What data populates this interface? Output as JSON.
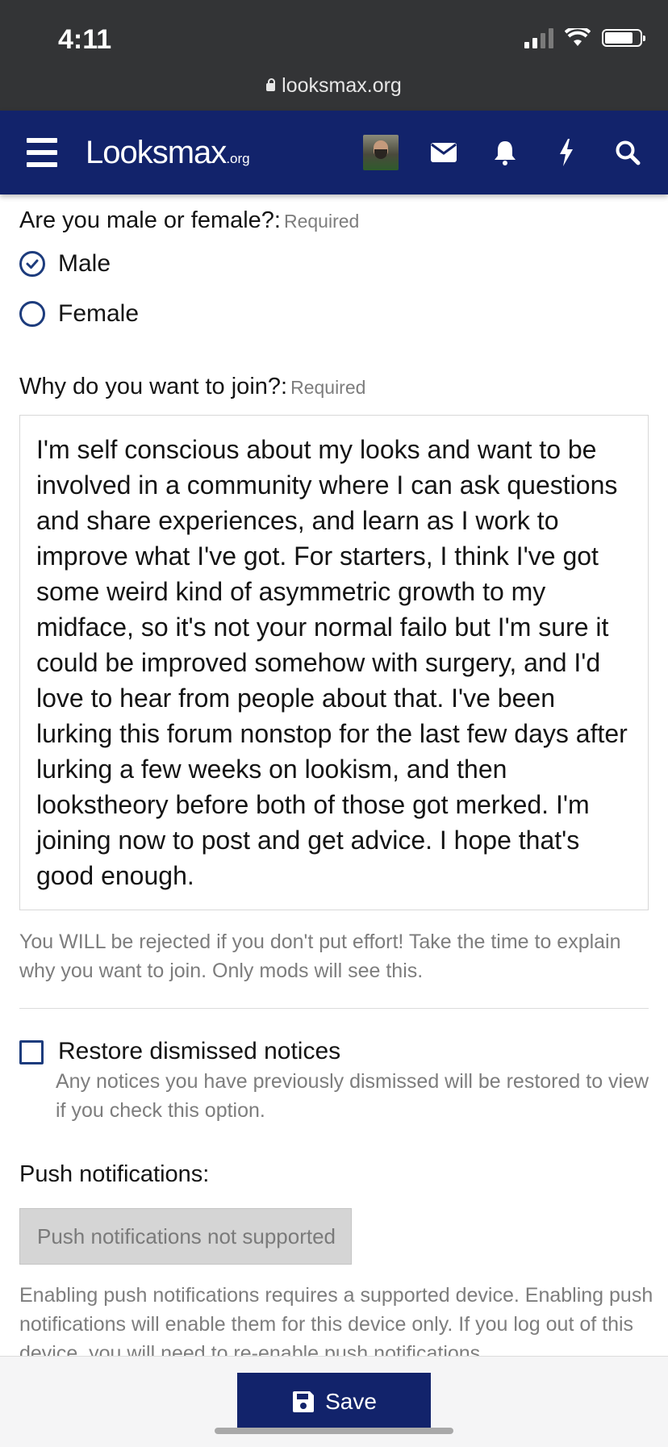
{
  "status_bar": {
    "time": "4:11"
  },
  "browser": {
    "url": "looksmax.org"
  },
  "header": {
    "logo": "Looksmax",
    "logo_suffix": ".org"
  },
  "form": {
    "gender": {
      "label": "Are you male or female?:",
      "required": "Required",
      "options": [
        {
          "label": "Male",
          "checked": true
        },
        {
          "label": "Female",
          "checked": false
        }
      ]
    },
    "why_join": {
      "label": "Why do you want to join?:",
      "required": "Required",
      "value": "I'm self conscious about my looks and want to be involved in a community where I can ask questions and share experiences, and learn as I work to improve what I've got. For starters, I think I've got some weird kind of asymmetric growth to my midface, so it's not your normal failo but I'm sure it could be improved somehow with surgery, and I'd love to hear from people about that. I've been lurking this forum nonstop for the last few days after lurking a few weeks on lookism, and then lookstheory before both of those got merked. I'm joining now to post and get advice. I hope that's good enough.",
      "hint": "You WILL be rejected if you don't put effort! Take the time to explain why you want to join. Only mods will see this."
    },
    "restore_notices": {
      "label": "Restore dismissed notices",
      "checked": false,
      "hint": "Any notices you have previously dismissed will be restored to view if you check this option."
    },
    "push": {
      "label": "Push notifications:",
      "button": "Push notifications not supported",
      "hint": "Enabling push notifications requires a supported device. Enabling push notifications will enable them for this device only. If you log out of this device, you will need to re-enable push notifications."
    }
  },
  "footer": {
    "save_label": "Save"
  },
  "colors": {
    "brand": "#12236b",
    "status_bar": "#333436",
    "accent": "#1d3c7d"
  }
}
